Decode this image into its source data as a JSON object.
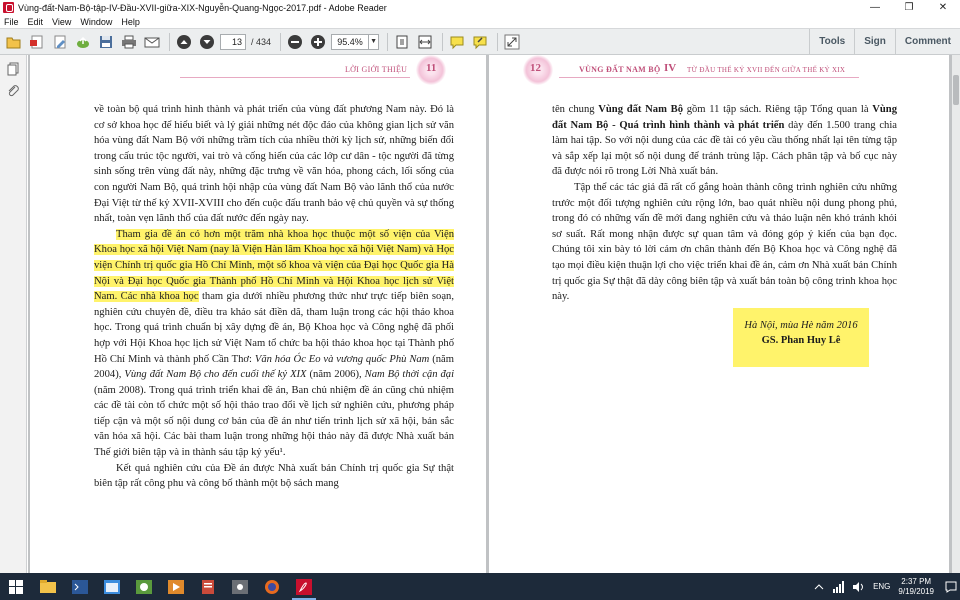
{
  "window": {
    "title": "Vùng-đất-Nam-Bộ-tập-IV-Đầu-XVII-giữa-XIX-Nguyễn-Quang-Ngọc-2017.pdf - Adobe Reader",
    "minimize_glyph": "—",
    "restore_glyph": "❐",
    "close_glyph": "✕"
  },
  "menu": [
    "File",
    "Edit",
    "View",
    "Window",
    "Help"
  ],
  "toolbar": {
    "page_current": "13",
    "page_total": "/ 434",
    "zoom": "95.4%",
    "tools_label": "Tools",
    "sign_label": "Sign",
    "comment_label": "Comment"
  },
  "page_left": {
    "header_label": "LỜI GIỚI THIỆU",
    "page_number": "11",
    "paragraphs": [
      "về toàn bộ quá trình hình thành và phát triển của vùng đất phương Nam này. Đó là cơ sở khoa học để hiểu biết và lý giải những nét độc đáo của không gian lịch sử văn hóa vùng đất Nam Bộ với những trầm tích của nhiều thời kỳ lịch sử, những biến đổi trong cấu trúc tộc người, vai trò và cống hiến của các lớp cư dân - tộc người đã từng sinh sống trên vùng đất này, những đặc trưng về văn hóa, phong cách, lối sống của con người Nam Bộ, quá trình hội nhập của vùng đất Nam Bộ vào lãnh thổ của nước Đại Việt từ thế kỷ XVII-XVIII cho đến cuộc đấu tranh bảo vệ chủ quyền và sự thống nhất, toàn vẹn lãnh thổ của đất nước đến ngày nay."
    ],
    "highlighted": "Tham gia đề án có hơn một trăm nhà khoa học thuộc một số viện của Viện Khoa học xã hội Việt Nam (nay là Viện Hàn lâm Khoa học xã hội Việt Nam) và Học viện Chính trị quốc gia Hồ Chí Minh, một số khoa và viện của Đại học Quốc gia Hà Nội và Đại học Quốc gia Thành phố Hồ Chí Minh và Hội Khoa học lịch sử Việt Nam. Các nhà khoa học",
    "continuation_a": " tham gia dưới nhiều phương thức như trực tiếp biên soạn, nghiên cứu chuyên đề, điều tra khảo sát điền dã, tham luận trong các hội thảo khoa học. Trong quá trình chuẩn bị xây dựng đề án, Bộ Khoa học và Công nghệ đã phối hợp với Hội Khoa học lịch sử Việt Nam tổ chức ba hội thảo khoa học tại Thành phố Hồ Chí Minh và thành phố Cần Thơ: ",
    "italic_1": "Văn hóa Óc Eo và vương quốc Phù Nam",
    "continuation_b": " (năm 2004), ",
    "italic_2": "Vùng đất Nam Bộ cho đến cuối thế kỷ XIX",
    "continuation_c": " (năm 2006), ",
    "italic_3": "Nam Bộ thời cận đại",
    "continuation_d": " (năm 2008). Trong quá trình triển khai đề án, Ban chủ nhiệm đề án cũng chủ nhiệm các đề tài còn tổ chức một số hội thảo trao đổi về lịch sử nghiên cứu, phương pháp tiếp cận và một số nội dung cơ bản của đề án như tiến trình lịch sử xã hội, bản sắc văn hóa xã hội. Các bài tham luận trong những hội thảo này đã được Nhà xuất bản Thế giới biên tập và in thành sáu tập kỷ yếu¹.",
    "last_paragraph": "Kết quả nghiên cứu của Đề án được Nhà xuất bản Chính trị quốc gia Sự thật biên tập rất công phu và công bố thành một bộ sách mang"
  },
  "page_right": {
    "page_number": "12",
    "header_title": "VÙNG ĐẤT NAM BỘ",
    "volume": "IV",
    "header_subtitle": "TỪ ĐẦU THẾ KỶ XVII ĐẾN GIỮA THẾ KỶ XIX",
    "p1_a": "tên chung ",
    "p1_b1": "Vùng đất Nam Bộ",
    "p1_c": " gồm 11 tập sách. Riêng tập Tổng quan là ",
    "p1_b2": "Vùng đất Nam Bộ - Quá trình hình thành và phát triển",
    "p1_d": " dày đến 1.500 trang chia làm hai tập. So với nội dung của các đề tài có yêu cầu thống nhất lại tên từng tập và sắp xếp lại một số nội dung để tránh trùng lặp. Cách phân tập và bố cục này đã được nói rõ trong Lời Nhà xuất bản.",
    "p2": "Tập thể các tác giả đã rất cố gắng hoàn thành công trình nghiên cứu những trước một đối tượng nghiên cứu rộng lớn, bao quát nhiều nội dung phong phú, trong đó có những vấn đề mới đang nghiên cứu và thảo luận nên khó tránh khỏi sơ suất. Rất mong nhận được sự quan tâm và đóng góp ý kiến của bạn đọc. Chúng tôi xin bày tỏ lời cảm ơn chân thành đến Bộ Khoa học và Công nghệ đã tạo mọi điều kiện thuận lợi cho việc triển khai đề án, cảm ơn Nhà xuất bản Chính trị quốc gia Sự thật đã dày công biên tập và xuất bản toàn bộ công trình khoa học này.",
    "sign_place": "Hà Nội, mùa Hè năm 2016",
    "sign_author": "GS. Phan Huy Lê"
  },
  "taskbar": {
    "lang": "ENG",
    "time": "2:37 PM",
    "date": "9/19/2019"
  },
  "colors": {
    "highlight": "#fff36b",
    "header_pink": "#c0507a",
    "taskbar": "#1d2a3a",
    "toolbar": "#eceeef"
  }
}
